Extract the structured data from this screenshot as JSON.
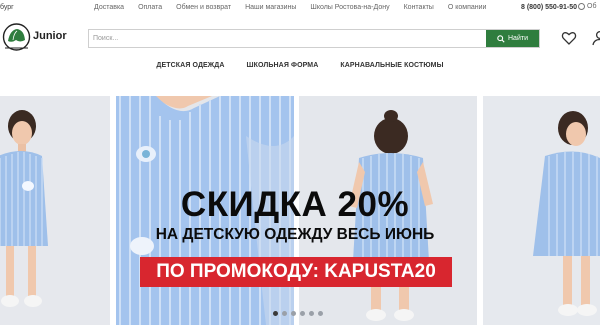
{
  "topbar": {
    "city": "бург",
    "nav": [
      "Доставка",
      "Оплата",
      "Обмен и возврат",
      "Наши магазины",
      "Школы Ростова-на-Дону",
      "Контакты",
      "О компании"
    ],
    "phone": "8 (800) 550-91-50",
    "callback": "Об"
  },
  "logo": {
    "seal_text": "Капуста Детская",
    "brand": "Junior"
  },
  "search": {
    "placeholder": "Поиск...",
    "button_label": "Найти"
  },
  "categories": [
    "ДЕТСКАЯ ОДЕЖДА",
    "ШКОЛЬНАЯ ФОРМА",
    "КАРНАВАЛЬНЫЕ КОСТЮМЫ"
  ],
  "banner": {
    "headline": "СКИДКА 20%",
    "subline": "НА ДЕТСКУЮ ОДЕЖДУ ВЕСЬ ИЮНЬ",
    "promo": "ПО ПРОМОКОДУ: KAPUSTA20",
    "slide_count": 6,
    "active_slide": 0
  },
  "colors": {
    "accent_green": "#2f7d3e",
    "promo_red": "#d8262f",
    "dress_blue": "#9fc0ea"
  }
}
